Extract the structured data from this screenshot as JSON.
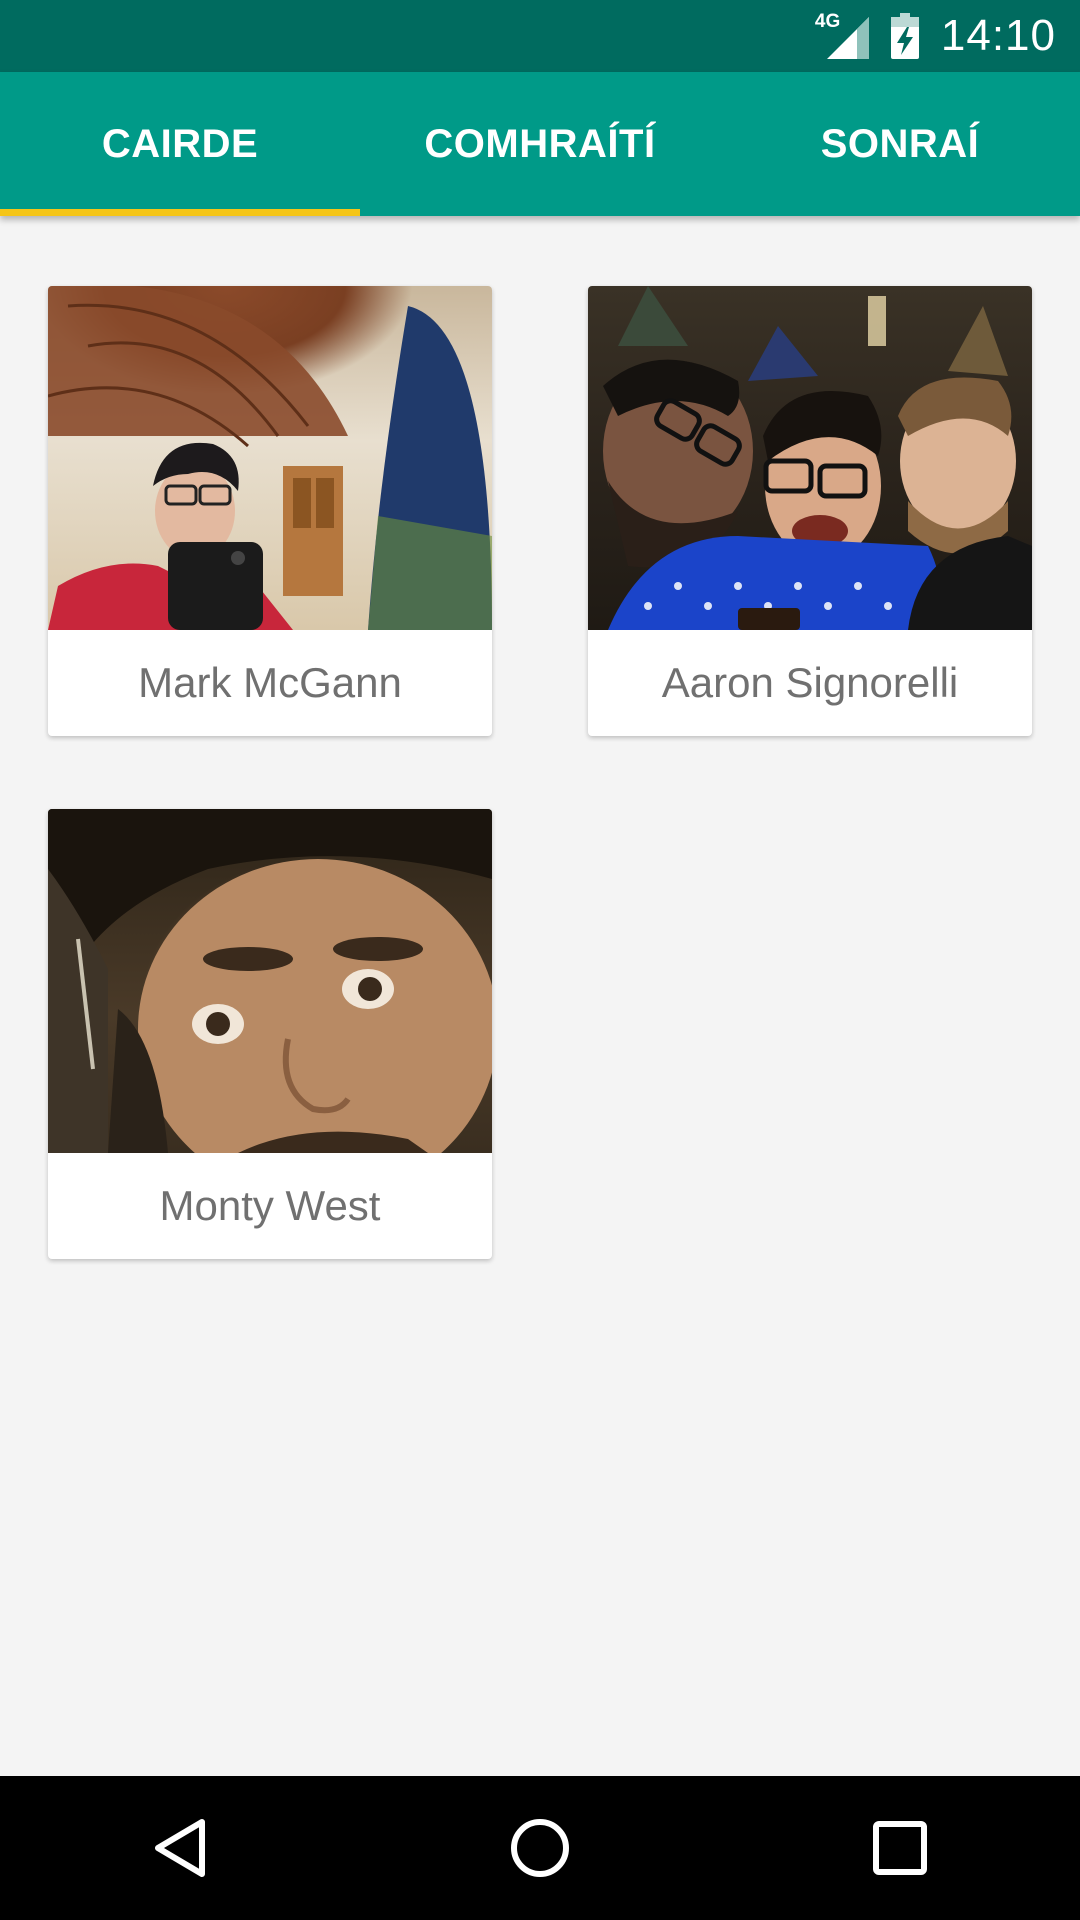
{
  "status_bar": {
    "network_label": "4G",
    "clock": "14:10",
    "icons": [
      "signal-icon",
      "battery-charging-icon"
    ]
  },
  "tabs": [
    {
      "label": "CAIRDE",
      "active": true
    },
    {
      "label": "COMHRAÍTÍ",
      "active": false
    },
    {
      "label": "SONRAÍ",
      "active": false
    }
  ],
  "contacts": [
    {
      "name": "Mark McGann"
    },
    {
      "name": "Aaron Signorelli"
    },
    {
      "name": "Monty West"
    }
  ],
  "navigation": {
    "icons": [
      "back-icon",
      "home-icon",
      "recents-icon"
    ]
  },
  "colors": {
    "status_bar": "#006b5f",
    "app_bar": "#009a88",
    "tab_indicator": "#f5c518",
    "background": "#f4f4f4",
    "card_text": "#707070"
  }
}
